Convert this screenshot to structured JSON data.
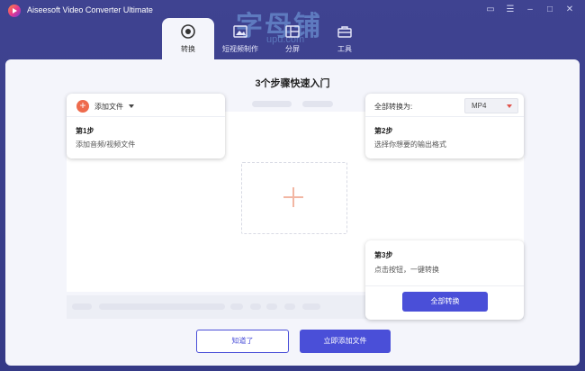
{
  "app": {
    "title": "Aiseesoft Video Converter Ultimate"
  },
  "watermark": {
    "text": "字母铺",
    "url": "upu.com"
  },
  "tabs": [
    {
      "label": "转换",
      "icon": "convert-icon",
      "active": true
    },
    {
      "label": "短视频制作",
      "icon": "image-icon",
      "active": false
    },
    {
      "label": "分屏",
      "icon": "split-screen-icon",
      "active": false
    },
    {
      "label": "工具",
      "icon": "toolbox-icon",
      "active": false
    }
  ],
  "guide": {
    "title": "3个步骤快速入门",
    "step1": {
      "add_label": "添加文件",
      "title": "第1步",
      "desc": "添加音频/视频文件"
    },
    "step2": {
      "format_label": "全部转换为:",
      "format_value": "MP4",
      "title": "第2步",
      "desc": "选择你想要的输出格式"
    },
    "step3": {
      "title": "第3步",
      "desc": "点击按钮，一键转换",
      "button": "全部转换"
    }
  },
  "footer": {
    "got_it": "知道了",
    "add_files_now": "立即添加文件"
  },
  "colors": {
    "accent": "#4a4fd8",
    "header_bg": "#3a3d8a",
    "add_orange": "#ee6b4d"
  }
}
